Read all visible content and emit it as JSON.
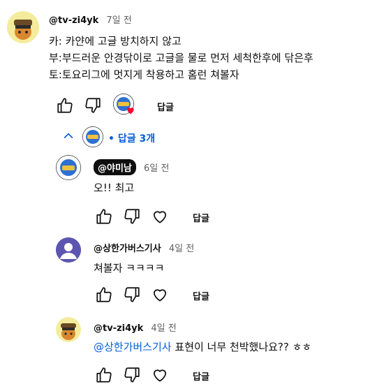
{
  "main_comment": {
    "handle": "@tv-zi4yk",
    "time": "7일 전",
    "lines": [
      "카: 카얀에 고글 방치하지 않고",
      "부:부드러운 안경닦이로 고글을  물로 먼저 세척한후에 닦은후",
      "토:토요리그에 멋지게 착용하고 홈런 쳐볼자"
    ],
    "reply_label": "답글"
  },
  "replies_toggle": {
    "label": "답글 3개",
    "bullet": "•"
  },
  "replies": [
    {
      "handle": "@야미남",
      "time": "6일 전",
      "text": "오!! 최고",
      "reply_label": "답글",
      "avatar_initial": ""
    },
    {
      "handle": "@상한가버스기사",
      "time": "4일 전",
      "text": "쳐볼자 ㅋㅋㅋㅋ",
      "reply_label": "답글",
      "avatar_color": "#5c56b0"
    },
    {
      "handle": "@tv-zi4yk",
      "time": "4일 전",
      "mention": "@상한가버스기사",
      "text": " 표현이 너무 천박했나요?? ㅎㅎ",
      "reply_label": "답글"
    }
  ],
  "colors": {
    "mention_blue": "#065fd4",
    "heart_red": "#ff0033",
    "text": "#0f0f0f",
    "muted": "#606060"
  },
  "icons": [
    "like-icon",
    "dislike-icon",
    "heart-icon",
    "chevron-up-icon"
  ]
}
